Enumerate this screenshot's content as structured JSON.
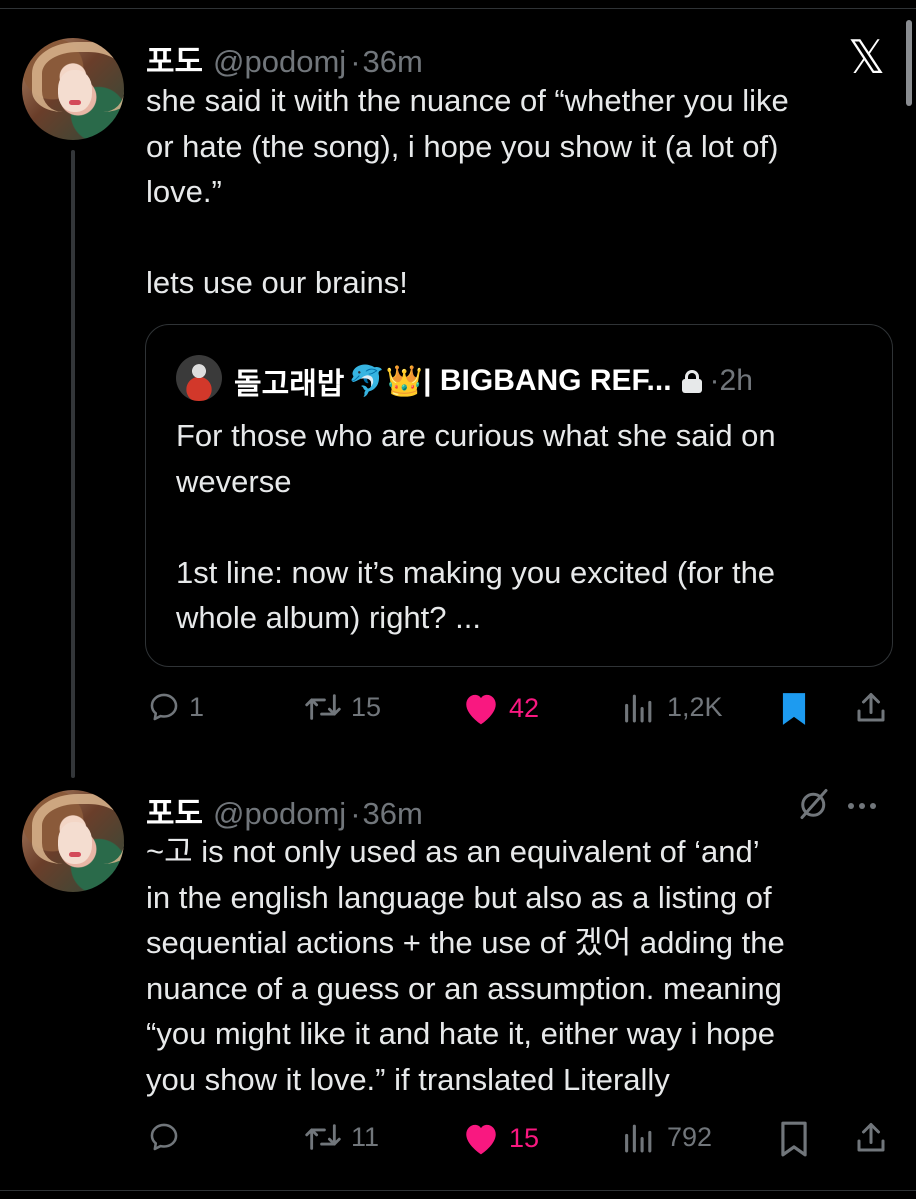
{
  "tweet1": {
    "display_name": "포도",
    "handle": "@podomj",
    "separator": "·",
    "time": "36m",
    "text": "she said it with the nuance of “whether you like\nor hate (the song), i hope you show it (a lot of)\nlove.”\n\nlets use our brains!",
    "quote": {
      "display_name": "돌고래밥",
      "emojis": "🐬👑",
      "name_suffix": " | BIGBANG REF...",
      "separator": "·",
      "time": "2h",
      "text": "For those who are curious what she said on\nweverse\n\n1st line: now it’s making you excited (for the\nwhole album) right? ..."
    },
    "actions": {
      "replies": "1",
      "reposts": "15",
      "likes": "42",
      "views": "1,2K"
    }
  },
  "tweet2": {
    "display_name": "포도",
    "handle": "@podomj",
    "separator": "·",
    "time": "36m",
    "text": "~고 is not only used as an equivalent of ‘and’\nin the english language but also as a listing of\nsequential actions + the use of 겠어 adding the\nnuance of a guess or an assumption. meaning\n“you might like it and hate it, either way i hope\nyou show it love.” if translated Literally",
    "actions": {
      "replies": "",
      "reposts": "11",
      "likes": "15",
      "views": "792"
    }
  },
  "brand_icon": "x-logo",
  "colors": {
    "background": "#000000",
    "text": "#e7e9ea",
    "muted": "#71767b",
    "like": "#f91880",
    "bookmark": "#1d9bf0"
  }
}
